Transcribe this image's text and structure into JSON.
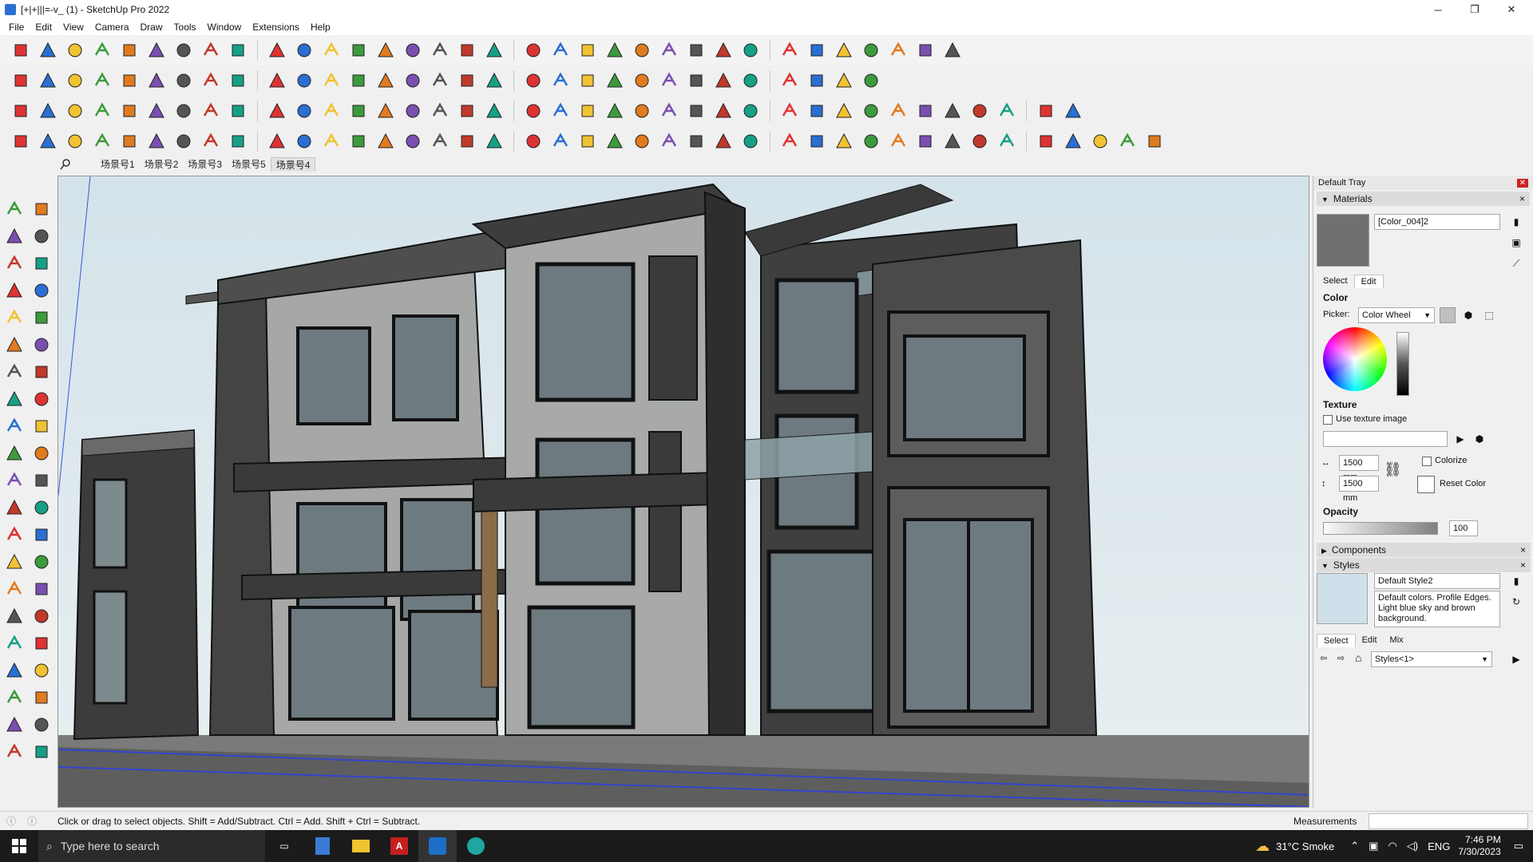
{
  "window": {
    "title": "[+|+|||=-v_ (1) - SketchUp Pro 2022",
    "minimize": "─",
    "maximize": "❐",
    "close": "✕"
  },
  "menu": [
    "File",
    "Edit",
    "View",
    "Camera",
    "Draw",
    "Tools",
    "Window",
    "Extensions",
    "Help"
  ],
  "scenes": {
    "tabs": [
      "场景号1",
      "场景号2",
      "场景号3",
      "场景号5",
      "场景号4"
    ],
    "active_index": 4
  },
  "tray": {
    "title": "Default Tray",
    "materials": {
      "header": "Materials",
      "name": "[Color_004]2",
      "tabs": [
        "Select",
        "Edit"
      ],
      "active_tab": "Edit",
      "color_label": "Color",
      "picker_label": "Picker:",
      "picker_value": "Color Wheel",
      "texture_label": "Texture",
      "use_texture_label": "Use texture image",
      "width": "1500 mm",
      "height": "1500 mm",
      "colorize_label": "Colorize",
      "reset_color_label": "Reset Color",
      "opacity_label": "Opacity",
      "opacity_value": "100",
      "swatch_color": "#707070"
    },
    "components": {
      "header": "Components"
    },
    "styles": {
      "header": "Styles",
      "name": "Default Style2",
      "description": "Default colors. Profile Edges. Light blue sky and brown background.",
      "tabs": [
        "Select",
        "Edit",
        "Mix"
      ],
      "active_tab": "Select",
      "collection": "Styles<1>"
    }
  },
  "status": {
    "hint": "Click or drag to select objects. Shift = Add/Subtract. Ctrl = Add. Shift + Ctrl = Subtract.",
    "measurements_label": "Measurements",
    "measurements_value": ""
  },
  "taskbar": {
    "search_placeholder": "Type here to search",
    "weather": "31°C  Smoke",
    "language": "ENG",
    "time": "7:46 PM",
    "date": "7/30/2023"
  },
  "icons": {
    "toolbar_row1": [
      "search-icon",
      "select-icon",
      "eraser-icon",
      "pencil-icon",
      "lasso-icon",
      "rectangle-icon",
      "pushpull-icon",
      "followme-icon",
      "move-icon",
      "rotate-icon",
      "scale-icon",
      "tape-icon",
      "text-icon",
      "paint-icon",
      "orbit-icon",
      "pan-icon",
      "zoom-icon",
      "zoom-extents-icon",
      "section-icon",
      "layers-icon",
      "styles-icon",
      "profile-icon",
      "model-info-icon",
      "component-icon",
      "warehouse-icon",
      "extension-icon",
      "axes-icon",
      "arrow-up-down-icon",
      "arrow-down-up-icon",
      "measure-icon",
      "sandbox-icon",
      "undo-icon",
      "redo-icon",
      "hand-icon"
    ],
    "toolbar_row2": [
      "iso-view-icon",
      "top-view-icon",
      "front-view-icon",
      "green-box-icon",
      "green-arrow-icon",
      "xray-icon",
      "backedge-icon",
      "wireframe-icon",
      "hidden-icon",
      "curve-icon",
      "push-red-icon",
      "push-blue-icon",
      "push-rr-icon",
      "push-g-icon",
      "push-f-icon",
      "push-x-icon",
      "push-m-icon",
      "cube-icon",
      "shed-icon",
      "house-icon",
      "house-roof-icon",
      "house-outline-icon",
      "house-open-icon",
      "brick-icon",
      "wall-icon",
      "roof-icon",
      "roof2-icon",
      "dome-icon",
      "fence-icon",
      "slope-icon",
      "fx-icon"
    ],
    "toolbar_row3": [
      "red-cube-icon",
      "blue-plane-icon",
      "yellow-plane-icon",
      "green-plane-icon",
      "red-plane-icon",
      "white-plane-icon",
      "orange-loop-icon",
      "red-square-icon",
      "grid-square-icon",
      "flag-icon",
      "chair-icon",
      "pipe-icon",
      "curve-line-icon",
      "path-icon",
      "cross-red-icon",
      "cross-green-icon",
      "cross-blue-icon",
      "cone-icon",
      "stairs-icon",
      "triangle-icon",
      "arc-icon",
      "hook-icon",
      "rotate-arc-icon",
      "transform-icon",
      "box-icon",
      "loop-red-icon",
      "circuit-icon",
      "group-icon",
      "copy-icon",
      "gem-icon",
      "tree-icon",
      "frame-icon",
      "wall-tile-icon",
      "window-icon",
      "table-icon",
      "cross-x-icon",
      "bezier-icon",
      "qr-icon"
    ],
    "toolbar_row4": [
      "line-edit-icon",
      "curve-edit-icon",
      "car-icon",
      "scissors-icon",
      "gear-icon",
      "cloud-icon",
      "spring-icon",
      "sphere-icon",
      "ring-icon",
      "arrow-curve-icon",
      "stool-icon",
      "hexagon-icon",
      "corner-icon",
      "corner2-icon",
      "line-red-icon",
      "sweep-icon",
      "arc-fan-icon",
      "cone-fan-icon",
      "column-icon",
      "palm-icon",
      "leaf-icon",
      "leaf2-icon",
      "sail-icon",
      "stairs2-icon",
      "plank-icon",
      "plank2-icon",
      "plank3-icon",
      "grass-icon",
      "wedge-icon",
      "cover-icon",
      "rails-icon",
      "fence2-icon",
      "hatch-icon",
      "stripes-icon",
      "blinds-icon",
      "grill-icon",
      "fan-icon",
      "fan2-icon",
      "bar-icon",
      "pin-icon",
      "cube-wire-icon"
    ],
    "left_tools": [
      "select-icon",
      "orbit-icon",
      "paint-icon",
      "eraser-icon",
      "component-icon",
      "pencil-icon",
      "line-icon",
      "freehand-icon",
      "rect-icon",
      "rotated-rect-icon",
      "circle-icon",
      "polygon-icon",
      "arc-icon",
      "pie-icon",
      "arc3-icon",
      "pie3-icon",
      "move-icon",
      "pushpull-icon",
      "rotate-icon",
      "followme-icon",
      "scale-icon",
      "offset-icon",
      "tape-icon",
      "dimension-icon",
      "protractor-icon",
      "text-icon",
      "axes-icon",
      "3dtext-icon",
      "orbit2-icon",
      "pan-icon",
      "zoom-icon",
      "zoomwin-icon",
      "zoomext-icon",
      "position-camera-icon",
      "walk-icon",
      "look-icon",
      "footprint-icon",
      "section-plane-icon",
      "layers-icon",
      "styles-icon",
      "shadow-icon",
      "fog-icon"
    ]
  }
}
